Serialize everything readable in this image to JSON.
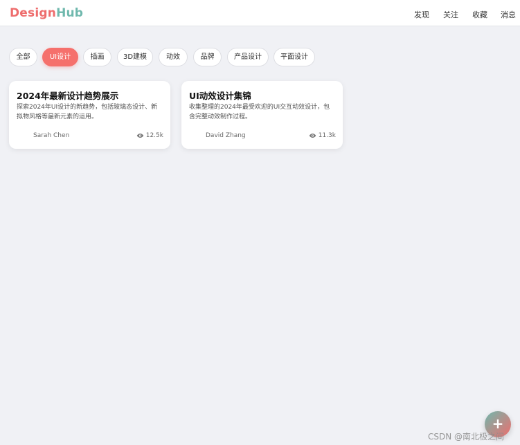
{
  "brand": {
    "part1": "Design",
    "part2": "Hub",
    "color1": "#ee6d6d",
    "color2": "#6fb8ad"
  },
  "nav": [
    {
      "label": "发现"
    },
    {
      "label": "关注"
    },
    {
      "label": "收藏"
    },
    {
      "label": "消息"
    }
  ],
  "filters": {
    "active_index": 1,
    "accent": "#f5706c",
    "items": [
      {
        "label": "全部"
      },
      {
        "label": "UI设计"
      },
      {
        "label": "插画"
      },
      {
        "label": "3D建模"
      },
      {
        "label": "动效"
      },
      {
        "label": "品牌"
      },
      {
        "label": "产品设计"
      },
      {
        "label": "平面设计"
      }
    ]
  },
  "cards": [
    {
      "title": "2024年最新设计趋势展示",
      "description": "探索2024年UI设计的新趋势，包括玻璃态设计、新拟物风格等最新元素的运用。",
      "author": "Sarah Chen",
      "views": "12.5k",
      "views_icon": "eye-icon"
    },
    {
      "title": "UI动效设计集锦",
      "description": "收集整理的2024年最受欢迎的UI交互动效设计，包含完整动效制作过程。",
      "author": "David Zhang",
      "views": "11.3k",
      "views_icon": "eye-icon"
    }
  ],
  "fab": {
    "label": "+",
    "icon": "plus-icon"
  },
  "watermark": "CSDN @南北极之间"
}
